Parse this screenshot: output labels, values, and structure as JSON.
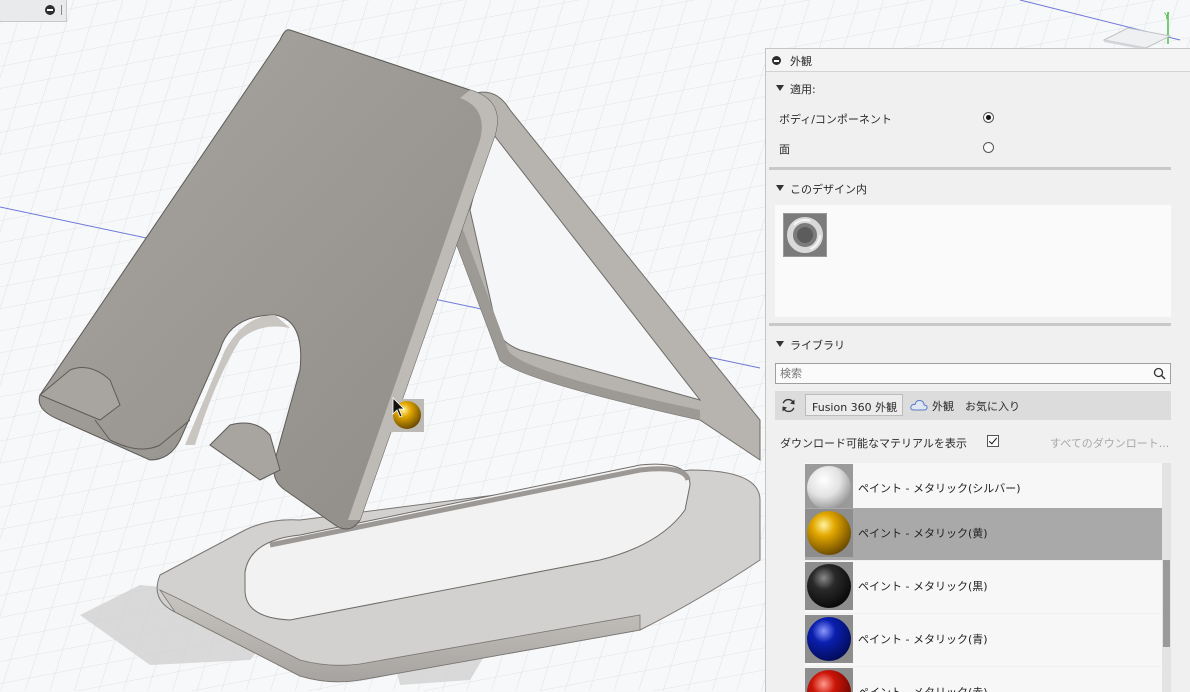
{
  "panel": {
    "title": "外観",
    "apply": {
      "header": "適用:",
      "options": [
        {
          "label": "ボディ/コンポーネント",
          "selected": true
        },
        {
          "label": "面",
          "selected": false
        }
      ]
    },
    "in_design": {
      "header": "このデザイン内",
      "items": [
        {
          "icon": "metal-ring-appearance-thumbnail"
        }
      ]
    },
    "library": {
      "header": "ライブラリ",
      "search_placeholder": "検索",
      "tabs": [
        "Fusion 360 外観",
        "外観",
        "お気に入り"
      ],
      "active_tab": "Fusion 360 外観",
      "download_label": "ダウンロード可能なマテリアルを表示",
      "download_checked": true,
      "download_all_label": "すべてのダウンロート...",
      "materials": [
        {
          "name": "ペイント - メタリック(シルバー)",
          "color": "#e2e2e2",
          "selected": false
        },
        {
          "name": "ペイント - メタリック(黄)",
          "color": "#e3a800",
          "selected": true
        },
        {
          "name": "ペイント - メタリック(黒)",
          "color": "#1d1d1d",
          "selected": false
        },
        {
          "name": "ペイント - メタリック(青)",
          "color": "#0a1fb0",
          "selected": false
        },
        {
          "name": "ペイント - メタリック(赤)",
          "color": "#cc1508",
          "selected": false
        }
      ]
    }
  },
  "viewport": {
    "model": "phone-stand",
    "drag_swatch_color": "#e3a800",
    "axis_label": "Y"
  }
}
